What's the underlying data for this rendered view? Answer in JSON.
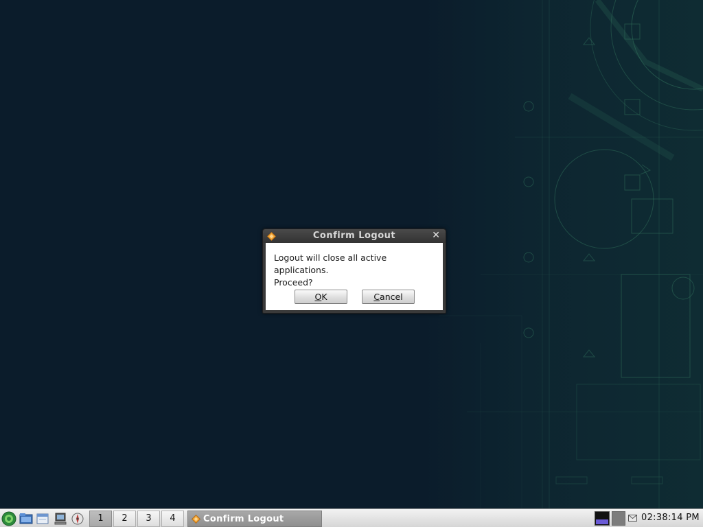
{
  "dialog": {
    "title": "Confirm Logout",
    "message_line1": "Logout will close all active applications.",
    "message_line2": "Proceed?",
    "ok_mnemonic": "O",
    "ok_rest": "K",
    "cancel_mnemonic": "C",
    "cancel_rest": "ancel",
    "close_glyph": "✕",
    "icon": "diamond-warning-icon"
  },
  "taskbar": {
    "launchers": [
      "main-menu-icon",
      "file-manager-icon",
      "window-icon",
      "computer-icon",
      "browser-icon"
    ],
    "desktops": [
      "1",
      "2",
      "3",
      "4"
    ],
    "active_desktop": "1",
    "task_item": "Confirm Logout",
    "clock": "02:38:14 PM"
  },
  "colors": {
    "desktop_bg": "#0b1c2b",
    "wallpaper_lines": "#2f6e5a",
    "dialog_frame": "#3a3a3a",
    "accent_orange": "#f0a030",
    "pager_active": "#6b5bd6"
  }
}
